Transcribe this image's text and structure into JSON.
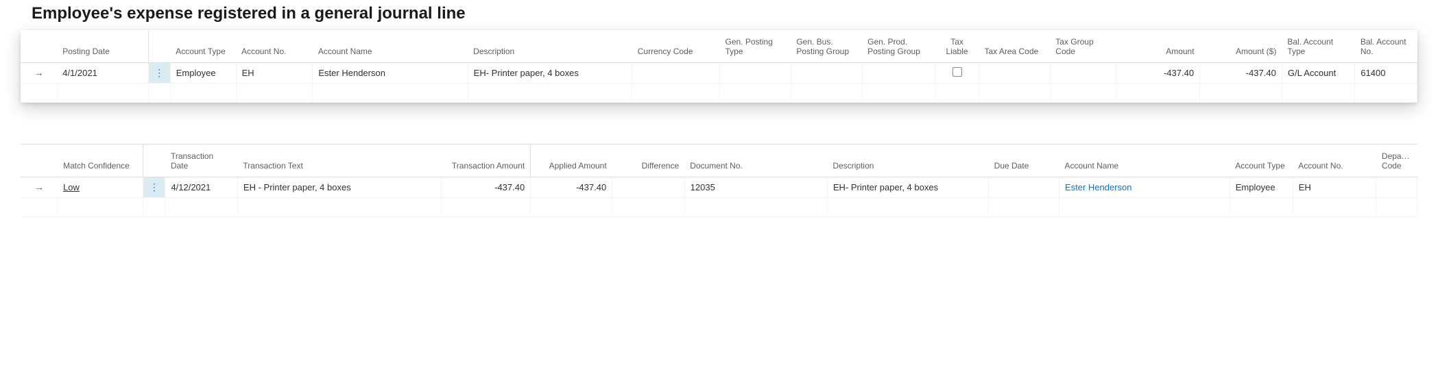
{
  "heading1": "Employee's expense registered in a general journal line",
  "table1": {
    "headers": {
      "posting_date": "Posting Date",
      "account_type": "Account Type",
      "account_no": "Account No.",
      "account_name": "Account Name",
      "description": "Description",
      "currency_code": "Currency Code",
      "gen_posting_type": "Gen. Posting Type",
      "gen_bus_posting_group": "Gen. Bus. Posting Group",
      "gen_prod_posting_group": "Gen. Prod. Posting Group",
      "tax_liable": "Tax Liable",
      "tax_area_code": "Tax Area Code",
      "tax_group_code": "Tax Group Code",
      "amount": "Amount",
      "amount_usd": "Amount ($)",
      "bal_account_type": "Bal. Account Type",
      "bal_account_no": "Bal. Account No."
    },
    "row": {
      "posting_date": "4/1/2021",
      "account_type": "Employee",
      "account_no": "EH",
      "account_name": "Ester Henderson",
      "description": "EH- Printer paper, 4 boxes",
      "currency_code": "",
      "gen_posting_type": "",
      "gen_bus_posting_group": "",
      "gen_prod_posting_group": "",
      "tax_liable": false,
      "tax_area_code": "",
      "tax_group_code": "",
      "amount": "-437.40",
      "amount_usd": "-437.40",
      "bal_account_type": "G/L Account",
      "bal_account_no": "61400"
    }
  },
  "table2": {
    "headers": {
      "match_confidence": "Match Confidence",
      "transaction_date": "Transaction Date",
      "transaction_text": "Transaction Text",
      "transaction_amount": "Transaction Amount",
      "applied_amount": "Applied Amount",
      "difference": "Difference",
      "document_no": "Document No.",
      "description": "Description",
      "due_date": "Due Date",
      "account_name": "Account Name",
      "account_type": "Account Type",
      "account_no": "Account No.",
      "depa_code": "Depa… Code"
    },
    "row": {
      "match_confidence": "Low",
      "transaction_date": "4/12/2021",
      "transaction_text": "EH - Printer paper, 4 boxes",
      "transaction_amount": "-437.40",
      "applied_amount": "-437.40",
      "difference": "",
      "document_no": "12035",
      "description": "EH- Printer paper, 4 boxes",
      "due_date": "",
      "account_name": "Ester Henderson",
      "account_type": "Employee",
      "account_no": "EH",
      "depa_code": ""
    }
  }
}
